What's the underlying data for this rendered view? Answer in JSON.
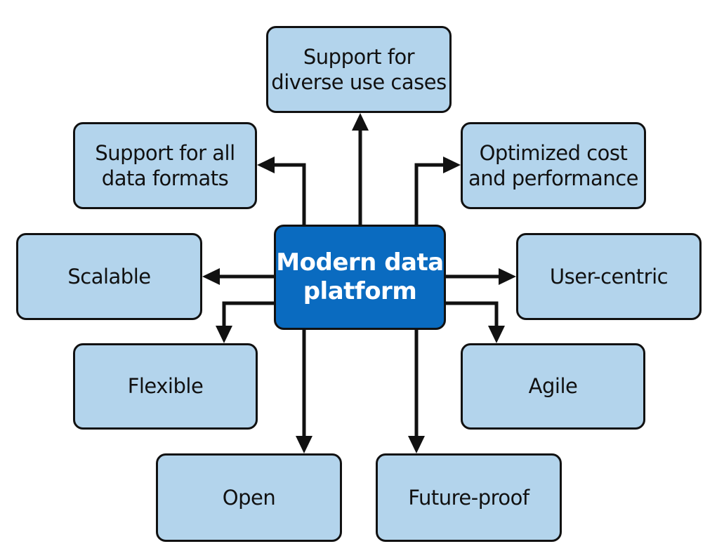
{
  "diagram": {
    "center": "Modern data\nplatform",
    "nodes": {
      "diverse": "Support for\ndiverse use cases",
      "formats": "Support for all\ndata formats",
      "optimized": "Optimized cost\nand performance",
      "scalable": "Scalable",
      "user_centric": "User-centric",
      "flexible": "Flexible",
      "agile": "Agile",
      "open": "Open",
      "future_proof": "Future-proof"
    },
    "edges": [
      {
        "from": "center",
        "to": "diverse"
      },
      {
        "from": "center",
        "to": "formats"
      },
      {
        "from": "center",
        "to": "optimized"
      },
      {
        "from": "center",
        "to": "scalable"
      },
      {
        "from": "center",
        "to": "user_centric"
      },
      {
        "from": "center",
        "to": "flexible"
      },
      {
        "from": "center",
        "to": "agile"
      },
      {
        "from": "center",
        "to": "open"
      },
      {
        "from": "center",
        "to": "future_proof"
      }
    ]
  },
  "colors": {
    "center_fill": "#0a6bc0",
    "node_fill": "#b3d4ec",
    "border": "#111111",
    "arrow": "#111111"
  }
}
